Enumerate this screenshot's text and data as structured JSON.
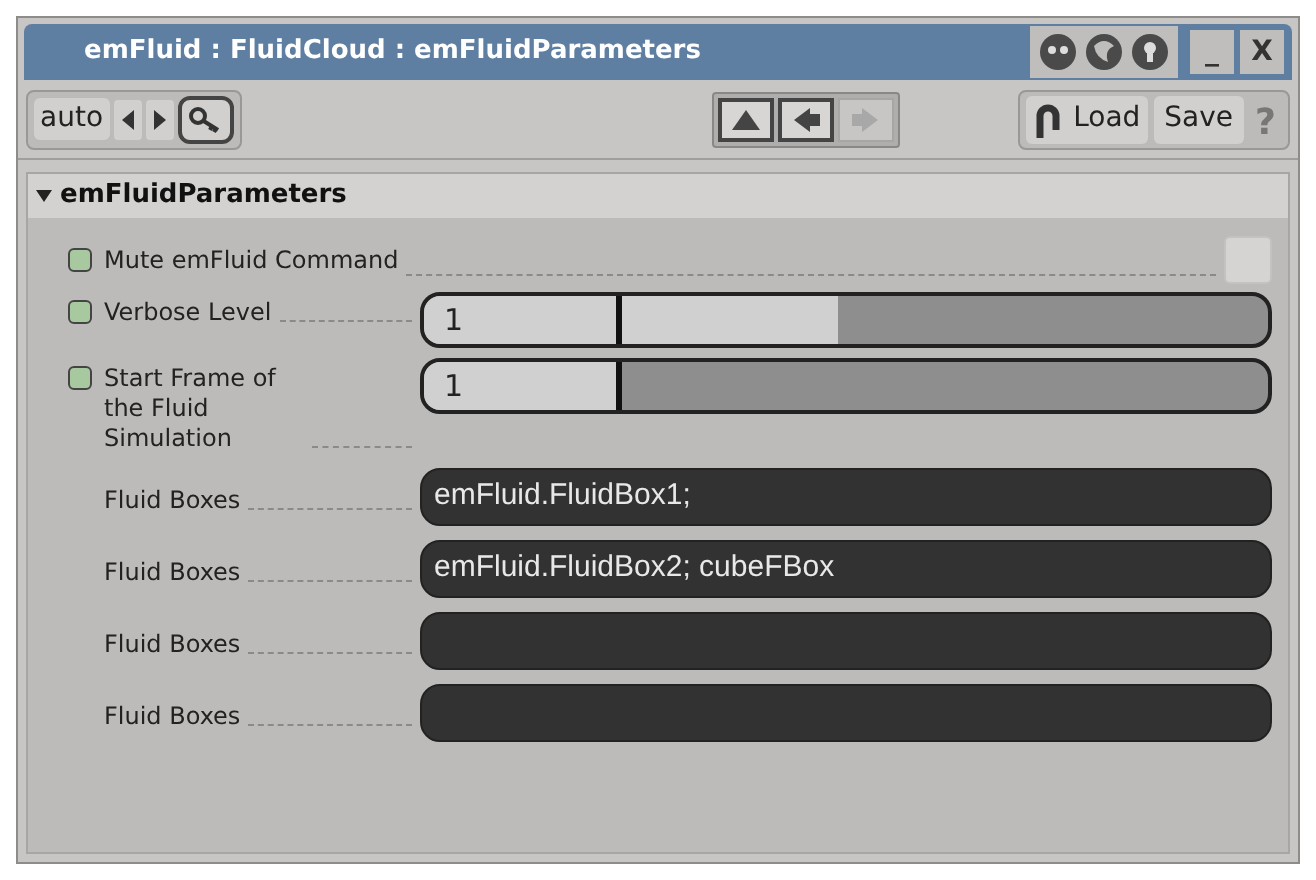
{
  "window": {
    "title": "emFluid : FluidCloud : emFluidParameters",
    "minimize": "_",
    "close": "X"
  },
  "toolbar": {
    "preset": "auto",
    "nav_buttons": [
      {
        "kind": "up",
        "disabled": false
      },
      {
        "kind": "left",
        "disabled": false
      },
      {
        "kind": "right",
        "disabled": true
      }
    ],
    "load": "Load",
    "save": "Save",
    "help": "?"
  },
  "section": {
    "title": "emFluidParameters",
    "expanded": true,
    "params": [
      {
        "kind": "checkbox",
        "label": "Mute emFluid Command",
        "keyable": true,
        "checked": false
      },
      {
        "kind": "slider",
        "label": "Verbose Level",
        "keyable": true,
        "value": "1",
        "level": 0.34
      },
      {
        "kind": "slider",
        "label": "Start Frame of the Fluid Simulation",
        "keyable": true,
        "value": "1",
        "level": 0
      },
      {
        "kind": "text",
        "label": "Fluid Boxes",
        "keyable": false,
        "value": "emFluid.FluidBox1;"
      },
      {
        "kind": "text",
        "label": "Fluid Boxes",
        "keyable": false,
        "value": "emFluid.FluidBox2; cubeFBox"
      },
      {
        "kind": "text",
        "label": "Fluid Boxes",
        "keyable": false
      },
      {
        "kind": "text",
        "label": "Fluid Boxes",
        "keyable": false
      }
    ]
  }
}
